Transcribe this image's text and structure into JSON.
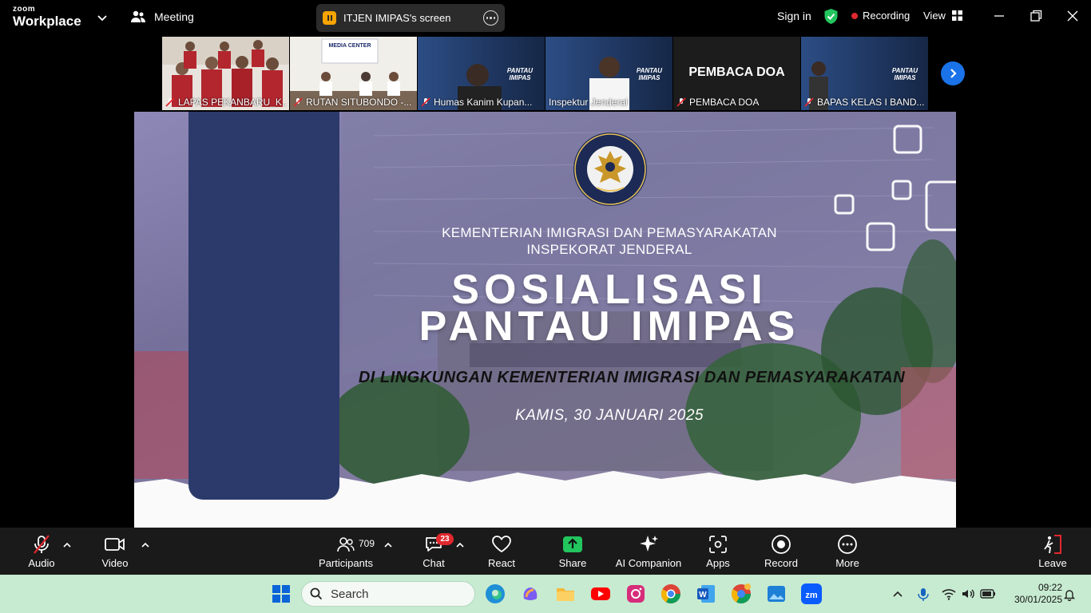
{
  "app": {
    "logo_line1": "zoom",
    "logo_line2": "Workplace",
    "meeting_label": "Meeting",
    "screen_share_title": "ITJEN IMIPAS's screen",
    "sign_in": "Sign in",
    "recording_label": "Recording",
    "view_label": "View"
  },
  "participants_strip": [
    {
      "name": "LAPAS PEKANBARU_K...",
      "muted": true,
      "active": false
    },
    {
      "name": "RUTAN SITUBONDO -...",
      "muted": true,
      "active": false
    },
    {
      "name": "Humas Kanim Kupan...",
      "muted": true,
      "active": false
    },
    {
      "name": "Inspektur Jenderal",
      "muted": false,
      "active": true
    },
    {
      "name": "PEMBACA DOA",
      "muted": true,
      "active": false,
      "avatar_text": "PEMBACA DOA"
    },
    {
      "name": "BAPAS KELAS I BAND...",
      "muted": true,
      "active": false
    }
  ],
  "slide": {
    "ministry_line1": "KEMENTERIAN IMIGRASI DAN PEMASYARAKATAN",
    "ministry_line2": "INSPEKORAT JENDERAL",
    "title_line1": "SOSIALISASI",
    "title_line2": "PANTAU IMIPAS",
    "subtitle": "DI LINGKUNGAN KEMENTERIAN IMIGRASI DAN PEMASYARAKATAN",
    "date": "KAMIS, 30 JANUARI 2025",
    "tile_thumb_label": "PANTAU IMIPAS"
  },
  "toolbar": {
    "audio": "Audio",
    "video": "Video",
    "participants": "Participants",
    "participants_count": "709",
    "chat": "Chat",
    "chat_badge": "23",
    "react": "React",
    "share": "Share",
    "ai_companion": "AI Companion",
    "apps": "Apps",
    "record": "Record",
    "more": "More",
    "leave": "Leave"
  },
  "taskbar": {
    "search_placeholder": "Search",
    "time": "09:22",
    "date": "30/01/2025"
  },
  "colors": {
    "active_outline": "#22c55e",
    "recording_dot": "#e0282e",
    "share_green": "#22c55e",
    "slide_blue_bar": "#2c3a6b",
    "taskbar_bg": "#c7ebd1"
  }
}
